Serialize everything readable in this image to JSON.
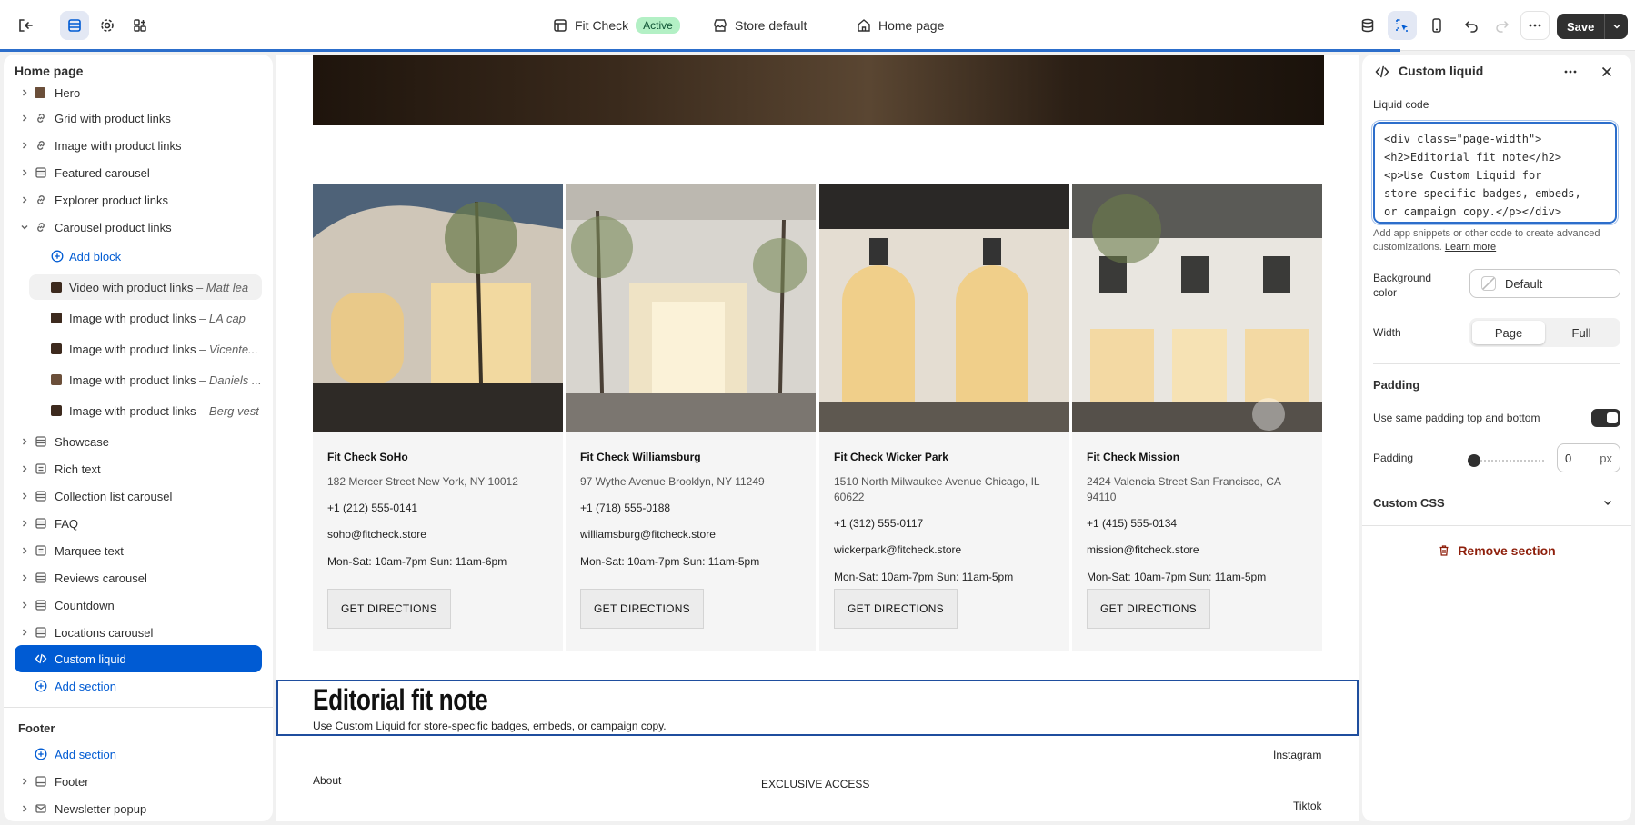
{
  "topbar": {
    "theme_name": "Fit Check",
    "theme_status": "Active",
    "market": "Store default",
    "page": "Home page",
    "save_label": "Save"
  },
  "sidebar": {
    "title": "Home page",
    "sections": [
      {
        "label": "Hero"
      },
      {
        "label": "Grid with product links"
      },
      {
        "label": "Image with product links"
      },
      {
        "label": "Featured carousel"
      },
      {
        "label": "Explorer product links"
      },
      {
        "label": "Carousel product links"
      }
    ],
    "add_block": "Add block",
    "blocks": [
      {
        "label": "Video with product links",
        "sub": "– Matt lea"
      },
      {
        "label": "Image with product links",
        "sub": "– LA cap"
      },
      {
        "label": "Image with product links",
        "sub": "– Vicente..."
      },
      {
        "label": "Image with product links",
        "sub": "– Daniels ..."
      },
      {
        "label": "Image with product links",
        "sub": "– Berg vest"
      }
    ],
    "sections2": [
      {
        "label": "Showcase"
      },
      {
        "label": "Rich text"
      },
      {
        "label": "Collection list carousel"
      },
      {
        "label": "FAQ"
      },
      {
        "label": "Marquee text"
      },
      {
        "label": "Reviews carousel"
      },
      {
        "label": "Countdown"
      },
      {
        "label": "Locations carousel"
      }
    ],
    "selected": "Custom liquid",
    "add_section": "Add section",
    "footer_title": "Footer",
    "footer_add_section": "Add section",
    "footer_items": [
      {
        "label": "Footer"
      },
      {
        "label": "Newsletter popup"
      }
    ]
  },
  "canvas": {
    "cards": [
      {
        "name": "Fit Check SoHo",
        "address": "182 Mercer Street New York, NY 10012",
        "phone": "+1 (212) 555-0141",
        "email": "soho@fitcheck.store",
        "hours": "Mon-Sat: 10am-7pm Sun: 11am-6pm",
        "cta": "GET DIRECTIONS"
      },
      {
        "name": "Fit Check Williamsburg",
        "address": "97 Wythe Avenue Brooklyn, NY 11249",
        "phone": "+1 (718) 555-0188",
        "email": "williamsburg@fitcheck.store",
        "hours": "Mon-Sat: 10am-7pm Sun: 11am-5pm",
        "cta": "GET DIRECTIONS"
      },
      {
        "name": "Fit Check Wicker Park",
        "address": "1510 North Milwaukee Avenue Chicago, IL 60622",
        "phone": "+1 (312) 555-0117",
        "email": "wickerpark@fitcheck.store",
        "hours": "Mon-Sat: 10am-7pm Sun: 11am-5pm",
        "cta": "GET DIRECTIONS"
      },
      {
        "name": "Fit Check Mission",
        "address": "2424 Valencia Street San Francisco, CA 94110",
        "phone": "+1 (415) 555-0134",
        "email": "mission@fitcheck.store",
        "hours": "Mon-Sat: 10am-7pm Sun: 11am-5pm",
        "cta": "GET DIRECTIONS"
      }
    ],
    "editorial_title": "Editorial fit note",
    "editorial_text": "Use Custom Liquid for store-specific badges, embeds, or campaign copy.",
    "footer": {
      "instagram": "Instagram",
      "about": "About",
      "exclusive": "EXCLUSIVE ACCESS",
      "tiktok": "Tiktok"
    }
  },
  "panel": {
    "title": "Custom liquid",
    "liquid_label": "Liquid code",
    "liquid_code": "<div class=\"page-width\">\n<h2>Editorial fit note</h2>\n<p>Use Custom Liquid for\nstore-specific badges, embeds,\nor campaign copy.</p></div>",
    "help_text": "Add app snippets or other code to create advanced customizations.",
    "learn_more": "Learn more",
    "bg_label": "Background color",
    "bg_value": "Default",
    "width_label": "Width",
    "width_options": [
      "Page",
      "Full"
    ],
    "width_selected": "Page",
    "padding_heading": "Padding",
    "same_padding_label": "Use same padding top and bottom",
    "same_padding_on": true,
    "padding_label": "Padding",
    "padding_value": "0",
    "padding_unit": "px",
    "custom_css": "Custom CSS",
    "remove": "Remove section"
  },
  "colors": {
    "accent": "#005bd3",
    "danger": "#8e1f0b",
    "badge_bg": "#b3f0c5"
  }
}
